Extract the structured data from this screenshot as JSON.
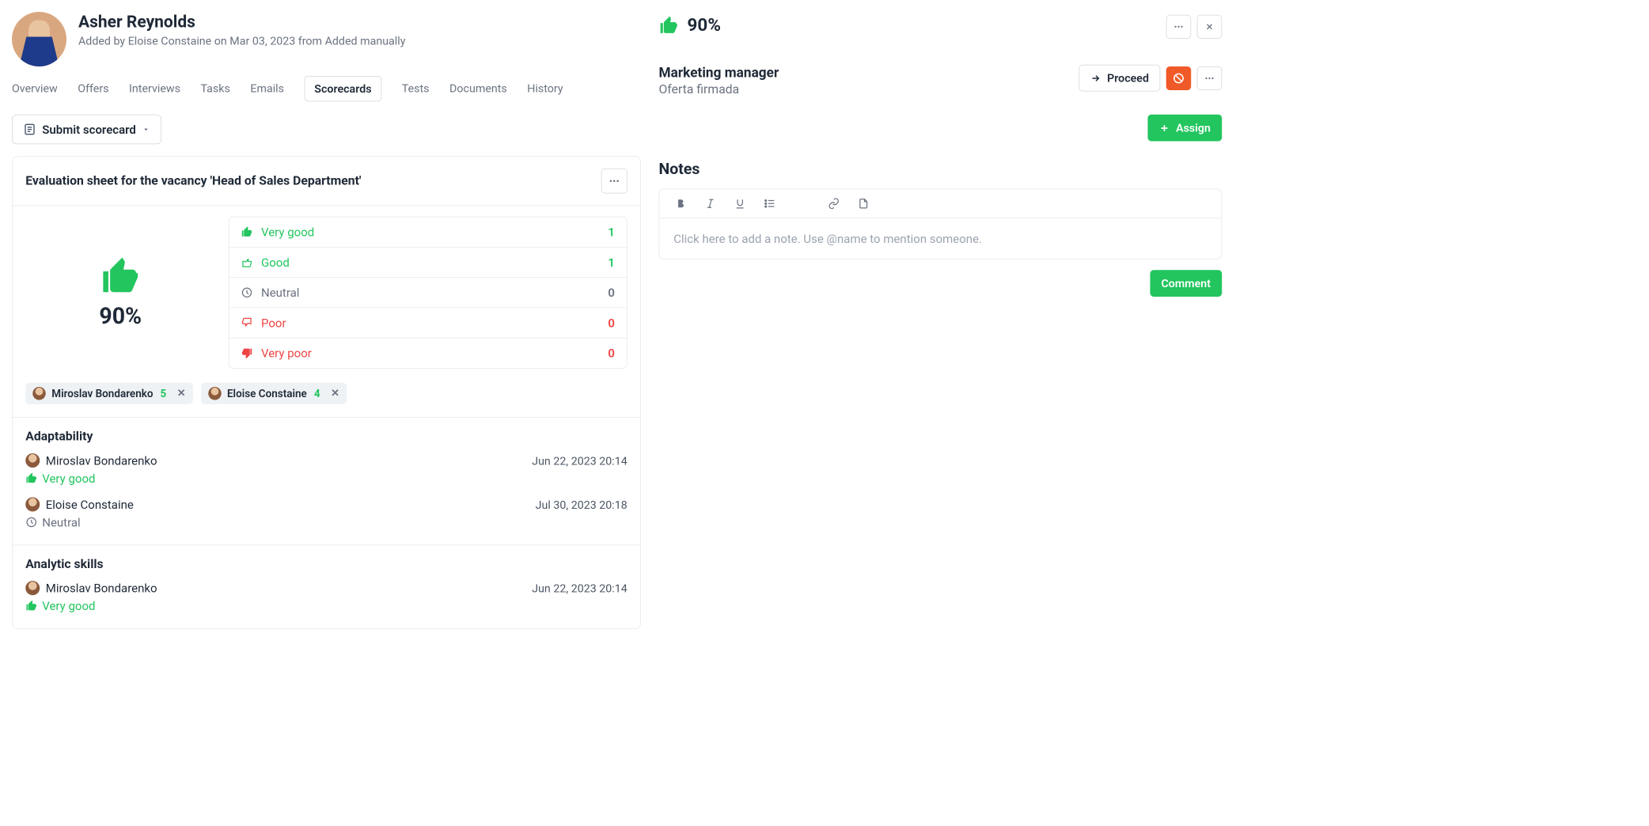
{
  "candidate": {
    "name": "Asher Reynolds",
    "meta": "Added by Eloise Constaine on Mar 03, 2023 from Added manually"
  },
  "tabs": {
    "items": [
      "Overview",
      "Offers",
      "Interviews",
      "Tasks",
      "Emails",
      "Scorecards",
      "Tests",
      "Documents",
      "History"
    ],
    "active": "Scorecards"
  },
  "submit_label": "Submit scorecard",
  "card": {
    "title": "Evaluation sheet for the vacancy 'Head of Sales Department'"
  },
  "summary": {
    "score_pct": "90%",
    "ratings": [
      {
        "label": "Very good",
        "count": "1",
        "tone": "green",
        "icon": "thumb-up"
      },
      {
        "label": "Good",
        "count": "1",
        "tone": "green",
        "icon": "thumb-up-outline"
      },
      {
        "label": "Neutral",
        "count": "0",
        "tone": "gray",
        "icon": "clock"
      },
      {
        "label": "Poor",
        "count": "0",
        "tone": "red",
        "icon": "thumb-down-outline"
      },
      {
        "label": "Very poor",
        "count": "0",
        "tone": "red",
        "icon": "thumb-down"
      }
    ]
  },
  "reviewers": [
    {
      "name": "Miroslav Bondarenko",
      "count": "5"
    },
    {
      "name": "Eloise Constaine",
      "count": "4"
    }
  ],
  "criteria": [
    {
      "title": "Adaptability",
      "reviews": [
        {
          "name": "Miroslav Bondarenko",
          "ts": "Jun 22, 2023 20:14",
          "rating": "Very good",
          "tone": "green",
          "icon": "thumb-up"
        },
        {
          "name": "Eloise Constaine",
          "ts": "Jul 30, 2023 20:18",
          "rating": "Neutral",
          "tone": "gray",
          "icon": "clock"
        }
      ]
    },
    {
      "title": "Analytic skills",
      "reviews": [
        {
          "name": "Miroslav Bondarenko",
          "ts": "Jun 22, 2023 20:14",
          "rating": "Very good",
          "tone": "green",
          "icon": "thumb-up"
        }
      ]
    }
  ],
  "right": {
    "score_pct": "90%",
    "position": "Marketing manager",
    "stage": "Oferta firmada",
    "proceed_label": "Proceed",
    "assign_label": "Assign",
    "notes_title": "Notes",
    "notes_placeholder": "Click here to add a note. Use @name to mention someone.",
    "comment_label": "Comment"
  }
}
